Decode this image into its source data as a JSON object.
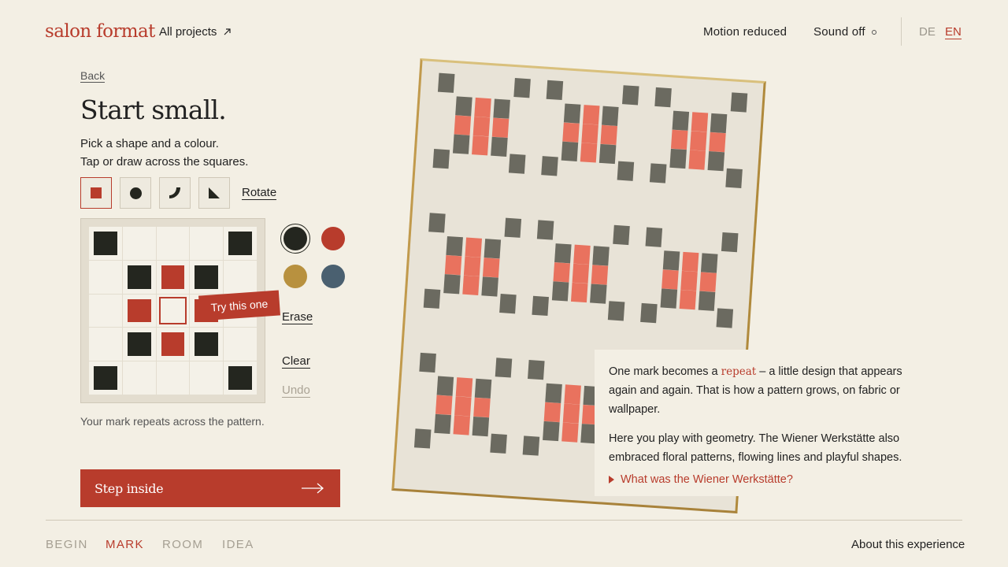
{
  "header": {
    "logo": "salon format",
    "all_projects": "All projects",
    "motion": "Motion reduced",
    "sound": "Sound off",
    "lang_de": "DE",
    "lang_en": "EN"
  },
  "panel": {
    "back": "Back",
    "title": "Start small.",
    "instruction_1": "Pick a shape and a colour.",
    "instruction_2": "Tap or draw across the squares.",
    "shapes": [
      "square-icon",
      "circle-icon",
      "quarter-arc-icon",
      "triangle-icon"
    ],
    "selected_shape": "square",
    "rotate": "Rotate",
    "grid": [
      [
        "black",
        "",
        "",
        "",
        "black"
      ],
      [
        "",
        "black",
        "red",
        "black",
        ""
      ],
      [
        "",
        "red",
        "selected",
        "red",
        ""
      ],
      [
        "",
        "black",
        "red",
        "black",
        ""
      ],
      [
        "black",
        "",
        "",
        "",
        "black"
      ]
    ],
    "tooltip": "Try this one",
    "colors": [
      {
        "name": "black",
        "hex": "#24261f",
        "selected": true
      },
      {
        "name": "red",
        "hex": "#b83c2c",
        "selected": false
      },
      {
        "name": "ochre",
        "hex": "#b8913f",
        "selected": false
      },
      {
        "name": "slate-blue",
        "hex": "#4a6070",
        "selected": false
      }
    ],
    "erase": "Erase",
    "clear": "Clear",
    "undo": "Undo",
    "caption": "Your mark repeats across the pattern.",
    "cta": "Step inside"
  },
  "info": {
    "p1_before": "One mark becomes a ",
    "p1_keyword": "repeat",
    "p1_after": " – a little design that appears again and again. That is how a pattern grows, on fabric or wallpaper.",
    "p2": "Here you play with geometry. The Wiener Werkstätte also embraced floral patterns, flowing lines and playful shapes.",
    "details": "What was the Wiener Werkstätte?"
  },
  "footer": {
    "steps": [
      "BEGIN",
      "MARK",
      "ROOM",
      "IDEA"
    ],
    "active_step": "MARK",
    "about": "About this experience"
  },
  "colors": {
    "accent": "#b83c2c",
    "background": "#f3efe4",
    "art_dark": "#6b6a60",
    "art_red": "#e9725e"
  }
}
